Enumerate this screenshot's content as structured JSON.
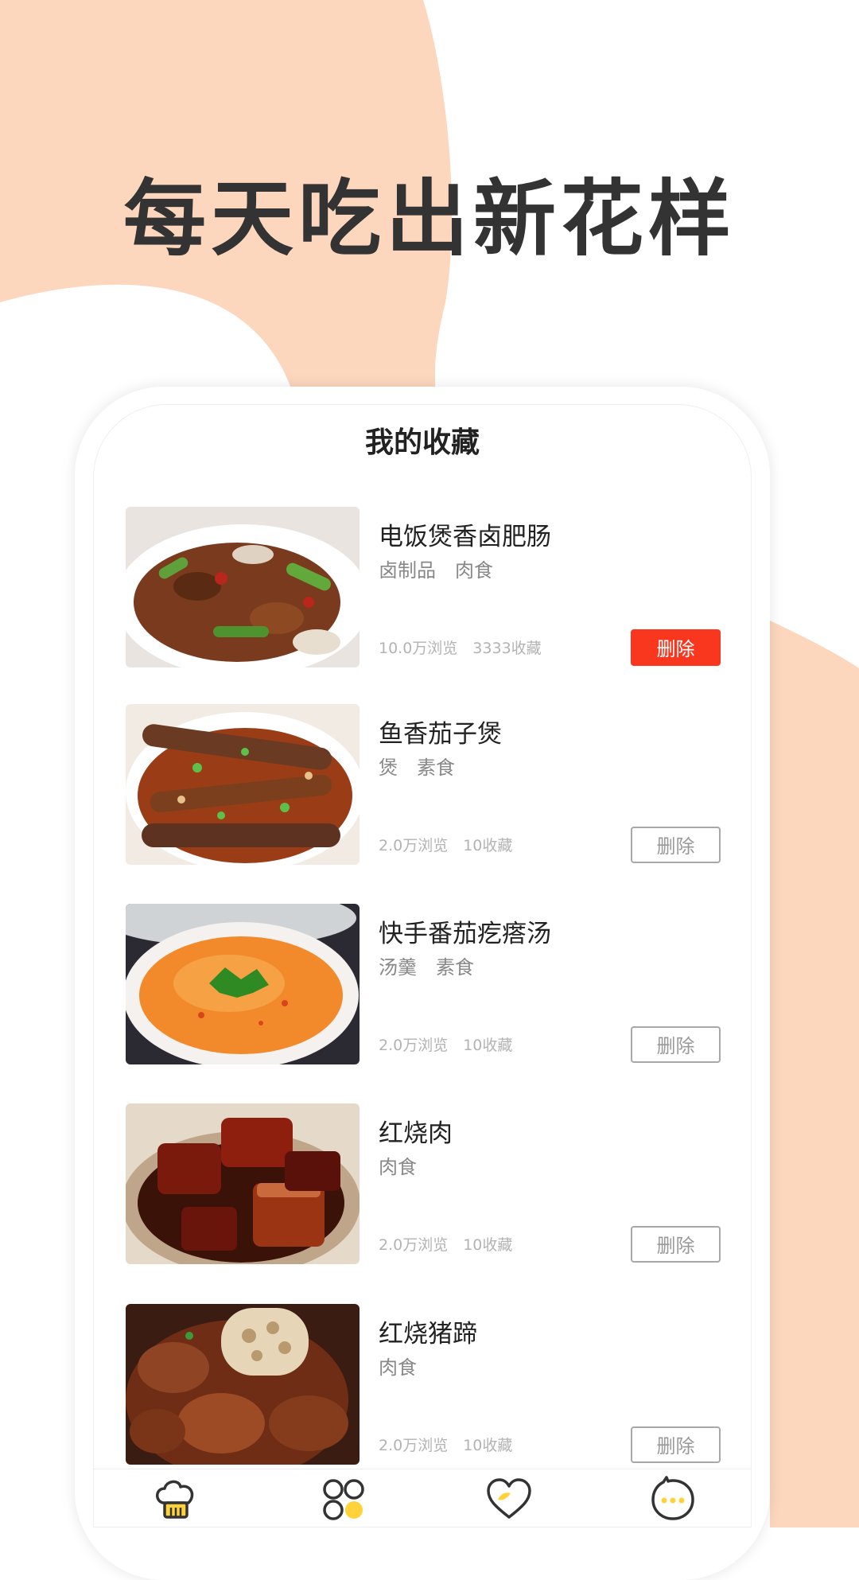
{
  "headline": "每天吃出新花样",
  "screen_title": "我的收藏",
  "colors": {
    "peach": "#fcd6bd",
    "delete_active": "#f8371e",
    "tab_accent": "#ffd23a"
  },
  "items": [
    {
      "title": "电饭煲香卤肥肠",
      "tags": "卤制品　肉食",
      "stats": "10.0万浏览　3333收藏",
      "delete_label": "删除",
      "delete_active": true
    },
    {
      "title": "鱼香茄子煲",
      "tags": "煲　素食",
      "stats": "2.0万浏览　10收藏",
      "delete_label": "删除",
      "delete_active": false
    },
    {
      "title": "快手番茄疙瘩汤",
      "tags": "汤羹　素食",
      "stats": "2.0万浏览　10收藏",
      "delete_label": "删除",
      "delete_active": false
    },
    {
      "title": "红烧肉",
      "tags": "肉食",
      "stats": "2.0万浏览　10收藏",
      "delete_label": "删除",
      "delete_active": false
    },
    {
      "title": "红烧猪蹄",
      "tags": "肉食",
      "stats": "2.0万浏览　10收藏",
      "delete_label": "删除",
      "delete_active": false
    }
  ],
  "tabbar": [
    {
      "icon": "chef-hat-icon"
    },
    {
      "icon": "categories-icon"
    },
    {
      "icon": "heart-icon"
    },
    {
      "icon": "chat-bubble-icon"
    }
  ]
}
